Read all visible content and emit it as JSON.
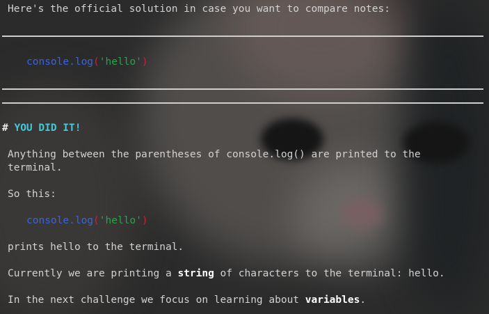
{
  "intro": "Here's the official solution in case you want to compare notes:",
  "solution_code": {
    "obj": "console",
    "dot": ".",
    "fn": "log",
    "open": "(",
    "arg": "'hello'",
    "close": ")"
  },
  "heading": {
    "hash": "#",
    "text": "YOU DID IT!"
  },
  "para1_line1": "Anything between the parentheses of console.log() are printed to the",
  "para1_line2": "terminal.",
  "so_this": "So this:",
  "example_code": {
    "obj": "console",
    "dot": ".",
    "fn": "log",
    "open": "(",
    "arg": "'hello'",
    "close": ")"
  },
  "prints": "prints hello to the terminal.",
  "currently": {
    "pre": "Currently we are printing a ",
    "bold": "string",
    "post": " of characters to the terminal: hello."
  },
  "next": {
    "pre": "In the next challenge we focus on learning about ",
    "bold": "variables",
    "post": "."
  },
  "colors": {
    "code_keyword": "#3a63e0",
    "code_paren": "#c8203f",
    "code_string": "#2aa34a",
    "heading": "#43c9d8"
  }
}
